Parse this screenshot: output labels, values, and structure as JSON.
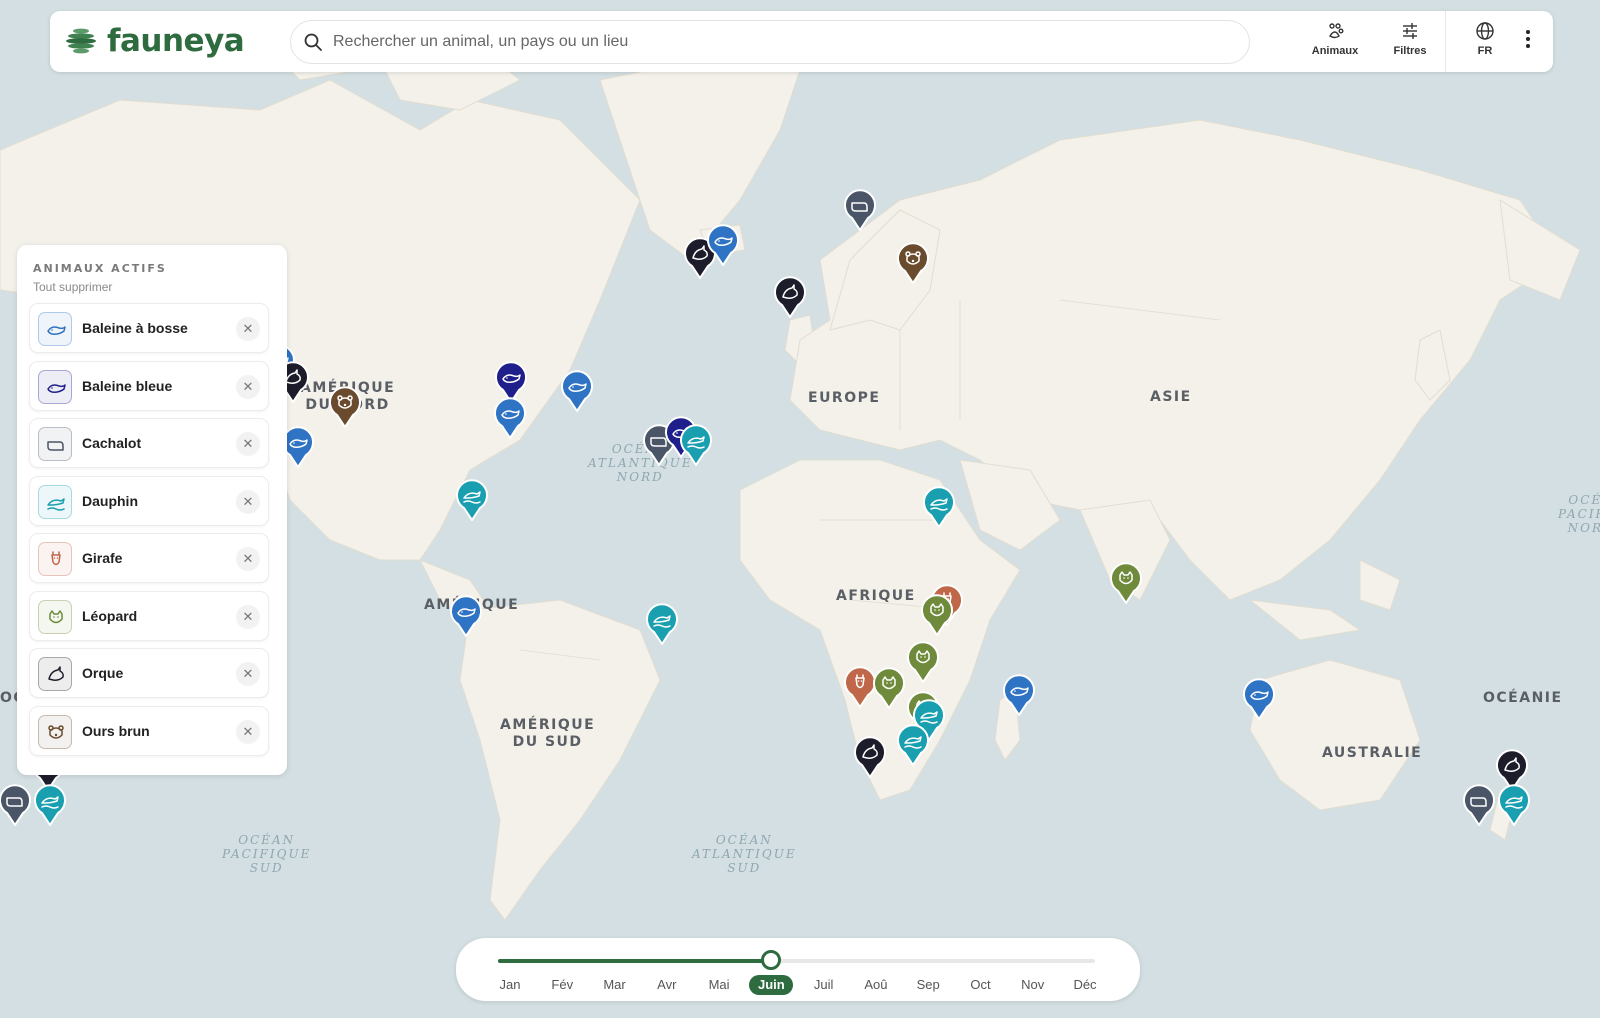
{
  "app": {
    "name": "fauneya"
  },
  "search": {
    "placeholder": "Rechercher un animal, un pays ou un lieu",
    "value": ""
  },
  "toolbar": {
    "animals_label": "Animaux",
    "filters_label": "Filtres",
    "language_label": "FR"
  },
  "panel": {
    "title": "ANIMAUX ACTIFS",
    "clear_all": "Tout supprimer",
    "remove_glyph": "✕",
    "items": [
      {
        "label": "Baleine à bosse",
        "icon": "humpback-whale-icon",
        "color": "#2f73c4"
      },
      {
        "label": "Baleine bleue",
        "icon": "blue-whale-icon",
        "color": "#1f1f8c"
      },
      {
        "label": "Cachalot",
        "icon": "sperm-whale-icon",
        "color": "#4a5568"
      },
      {
        "label": "Dauphin",
        "icon": "dolphin-icon",
        "color": "#1a9fb0"
      },
      {
        "label": "Girafe",
        "icon": "giraffe-icon",
        "color": "#c0674a"
      },
      {
        "label": "Léopard",
        "icon": "leopard-icon",
        "color": "#6f8a3a"
      },
      {
        "label": "Orque",
        "icon": "orca-icon",
        "color": "#1c1c2b"
      },
      {
        "label": "Ours brun",
        "icon": "brown-bear-icon",
        "color": "#6b4b2e"
      }
    ]
  },
  "map": {
    "regions": {
      "north_america": "AMÉRIQUE\nDU NORD",
      "america": "AMÉRIQUE",
      "south_america": "AMÉRIQUE\nDU SUD",
      "europe": "EUROPE",
      "asia": "ASIE",
      "africa": "AFRIQUE",
      "australia": "AUSTRALIE",
      "oceania": "OCÉANIE",
      "oceania_left": "OC"
    },
    "oceans": {
      "north_atlantic": "OCÉAN\nATLANTIQUE\nNORD",
      "south_pacific": "OCÉAN\nPACIFIQUE\nSUD",
      "south_atlantic": "OCÉAN\nATLANTIQUE\nSUD",
      "north_pacific_right": "OCÉ\nPACIFI\nNOR"
    }
  },
  "timeline": {
    "months": [
      "Jan",
      "Fév",
      "Mar",
      "Avr",
      "Mai",
      "Juin",
      "Juil",
      "Aoû",
      "Sep",
      "Oct",
      "Nov",
      "Déc"
    ],
    "selected": "Juin",
    "selected_index": 5
  },
  "colors": {
    "brand": "#2e6b3f",
    "land": "#f3f1ea",
    "water": "#d3dfe2"
  }
}
